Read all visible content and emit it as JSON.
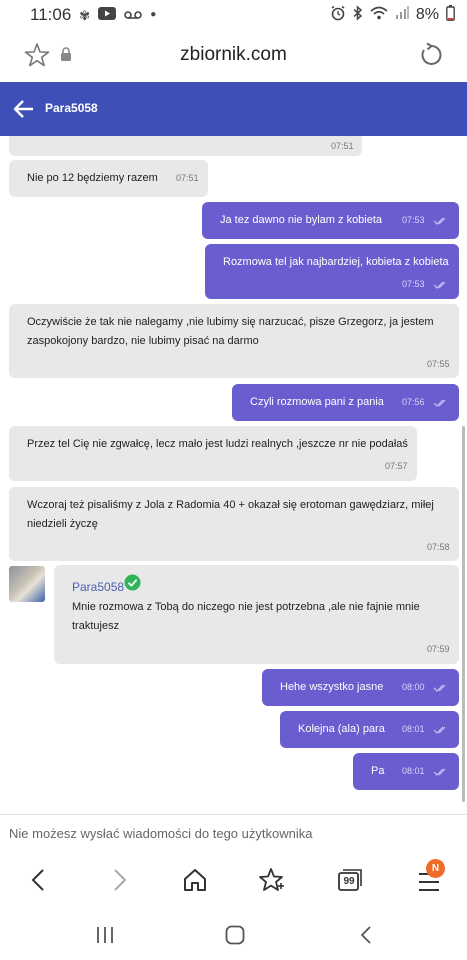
{
  "status_bar": {
    "time": "11:06",
    "battery": "8%"
  },
  "browser": {
    "url": "zbiornik.com"
  },
  "chat": {
    "title": "Para5058"
  },
  "messages": [
    {
      "dir": "in",
      "text": "",
      "time": "07:51"
    },
    {
      "dir": "in",
      "text": "Nie po 12 będziemy razem",
      "time": "07:51"
    },
    {
      "dir": "out",
      "text": "Ja tez dawno nie bylam z kobieta",
      "time": "07:53"
    },
    {
      "dir": "out",
      "text": "Rozmowa tel jak najbardziej, kobieta z kobieta",
      "time": "07:53"
    },
    {
      "dir": "in",
      "text_line1": "Oczywiście że tak nie nalegamy ,nie lubimy się narzucać, pisze Grzegorz, ja jestem",
      "text_line2": "zaspokojony bardzo, nie lubimy pisać na darmo",
      "time": "07:55"
    },
    {
      "dir": "out",
      "text": "Czyli rozmowa pani z pania",
      "time": "07:56"
    },
    {
      "dir": "in",
      "text": "Przez tel Cię nie zgwałcę, lecz mało jest ludzi realnych ,jeszcze nr nie podałaś",
      "time": "07:57"
    },
    {
      "dir": "in",
      "text_line1": "Wczoraj też pisaliśmy z Jola z Radomia 40 + okazał się erotoman gawędziarz, miłej",
      "text_line2": "niedzieli życzę",
      "time": "07:58"
    },
    {
      "dir": "in",
      "sender": "Para5058",
      "text_line1": "Mnie rozmowa z Tobą do niczego nie jest potrzebna ,ale nie fajnie mnie",
      "text_line2": "traktujesz",
      "time": "07:59"
    },
    {
      "dir": "out",
      "text": "Hehe wszystko jasne",
      "time": "08:00"
    },
    {
      "dir": "out",
      "text": "Kolejna (ala) para",
      "time": "08:01"
    },
    {
      "dir": "out",
      "text": "Pa",
      "time": "08:01"
    }
  ],
  "composer": {
    "notice": "Nie możesz wysłać wiadomości do tego użytkownika"
  },
  "browser_nav": {
    "tabs_count": "99",
    "notification_badge": "N"
  },
  "colors": {
    "header": "#3e50b8",
    "outgoing": "#6a5dd0",
    "incoming": "#e8e8e8",
    "badge": "#f06a2a"
  }
}
